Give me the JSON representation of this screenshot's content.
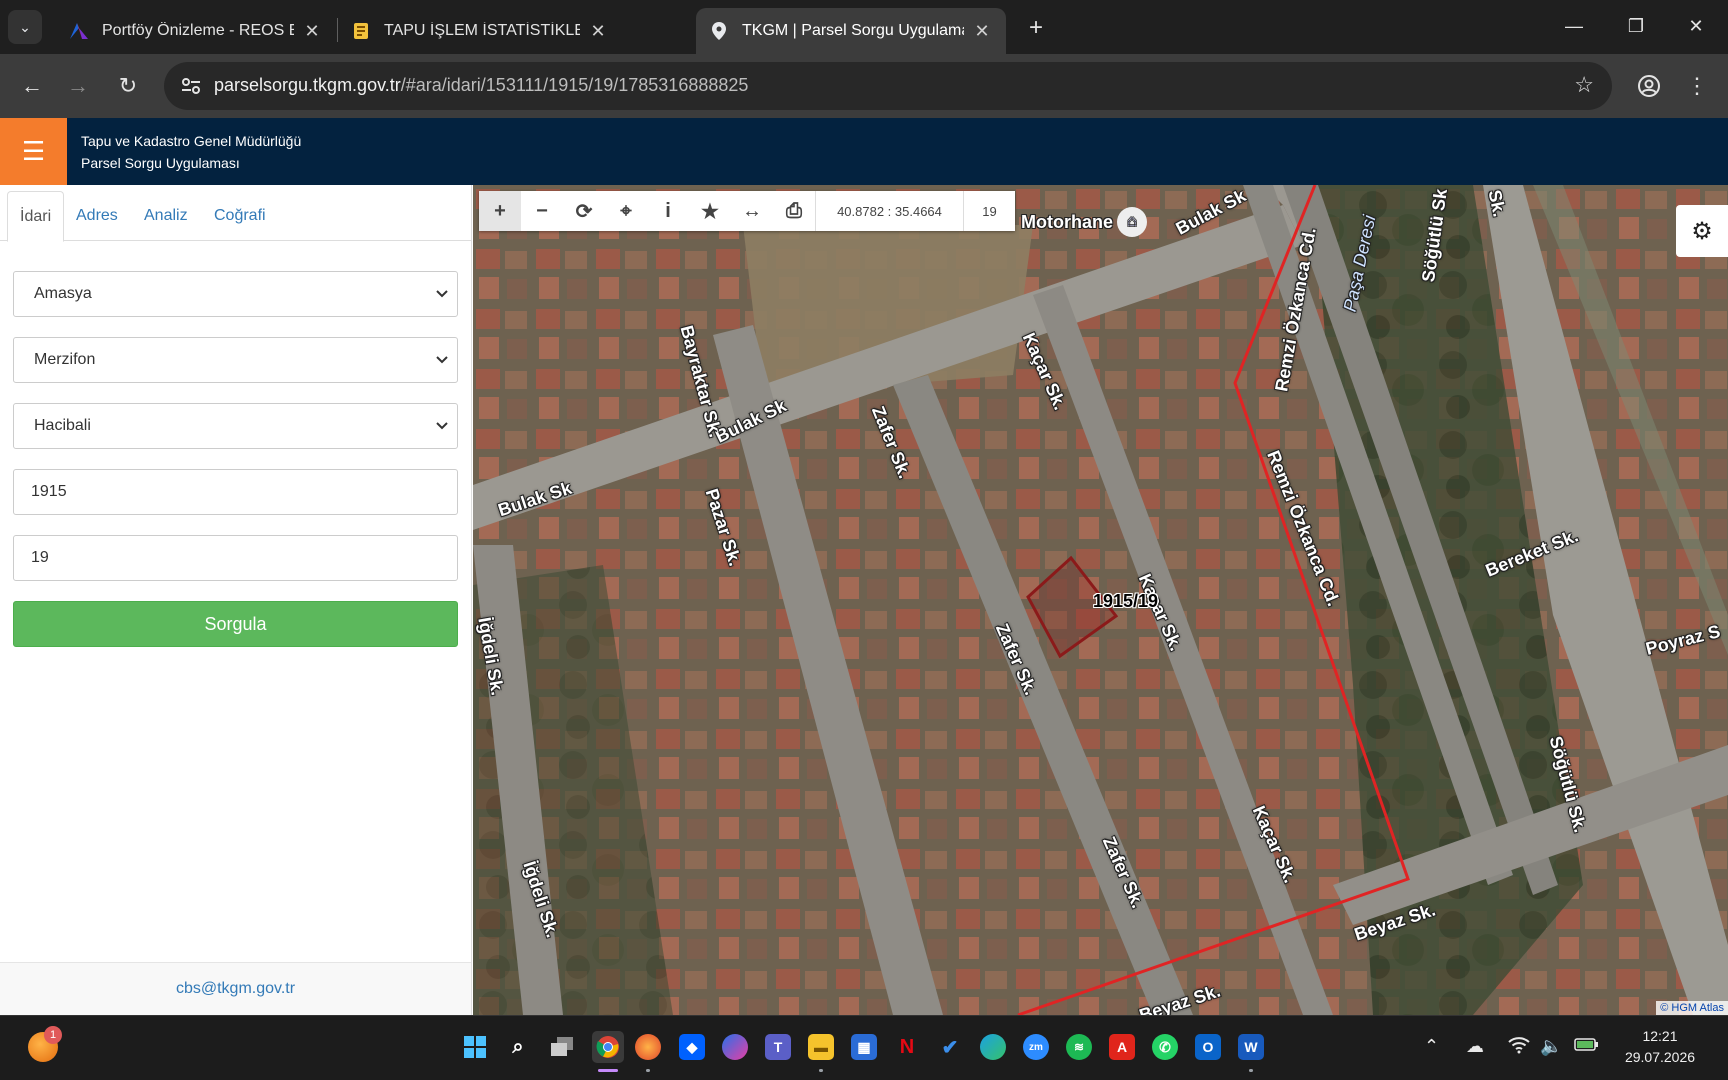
{
  "browser": {
    "tabs": [
      {
        "title": "Portföy Önizleme - REOS Emlak",
        "active": false
      },
      {
        "title": "TAPU İŞLEM İSTATİSTİKLERİ | Tap",
        "active": false
      },
      {
        "title": "TKGM | Parsel Sorgu Uygulamas",
        "active": true
      }
    ],
    "url_host": "parselsorgu.tkgm.gov.tr",
    "url_path": "/#ara/idari/153111/1915/19/1785316888825"
  },
  "app": {
    "org_name": "Tapu ve Kadastro Genel Müdürlüğü",
    "app_name": "Parsel Sorgu Uygulaması"
  },
  "sidebar": {
    "tabs": [
      {
        "label": "İdari",
        "active": true
      },
      {
        "label": "Adres",
        "active": false
      },
      {
        "label": "Analiz",
        "active": false
      },
      {
        "label": "Coğrafi",
        "active": false
      }
    ],
    "province": "Amasya",
    "district": "Merzifon",
    "neighborhood": "Hacibali",
    "block_no": "1915",
    "parcel_no": "19",
    "query_button": "Sorgula",
    "footer_email": "cbs@tkgm.gov.tr"
  },
  "map": {
    "coordinates": "40.8782 : 35.4664",
    "zoom": "19",
    "poi": "Motorhane",
    "parcel_label": "1915/19",
    "attribution": "© HGM Atlas",
    "streets": [
      "Bulak Sk",
      "Bulak Sk",
      "Bulak Sk",
      "Bayraktar Sk.",
      "Pazar Sk.",
      "Zafer Sk.",
      "Zafer Sk.",
      "Zafer Sk.",
      "Kaçar Sk.",
      "Kaçar Sk.",
      "Kaçar Sk.",
      "Remzi Özkanca Cd.",
      "Remzi Özkanca Cd.",
      "Paşa Deresi",
      "Söğütlü Sk",
      "Söğütlü Sk.",
      "Bereket Sk.",
      "Poyraz S",
      "Beyaz Sk.",
      "Beyaz Sk.",
      "İğdeli Sk.",
      "İğdeli Sk.",
      "Sk."
    ],
    "colors": {
      "parcel": "#8b1a1a",
      "selection": "#e02424"
    }
  },
  "taskbar": {
    "weather_badge": "1",
    "time": "12:21",
    "date": "29.07.2026",
    "icons": [
      "windows-start-icon",
      "search-icon",
      "task-view-icon",
      "chrome-icon",
      "firefox-icon",
      "dropbox-icon",
      "copilot-icon",
      "teams-icon",
      "file-explorer-icon",
      "store-icon",
      "netflix-icon",
      "todo-icon",
      "edge-icon",
      "zoom-icon",
      "spotify-icon",
      "acrobat-icon",
      "whatsapp-icon",
      "outlook-icon",
      "word-icon"
    ]
  }
}
